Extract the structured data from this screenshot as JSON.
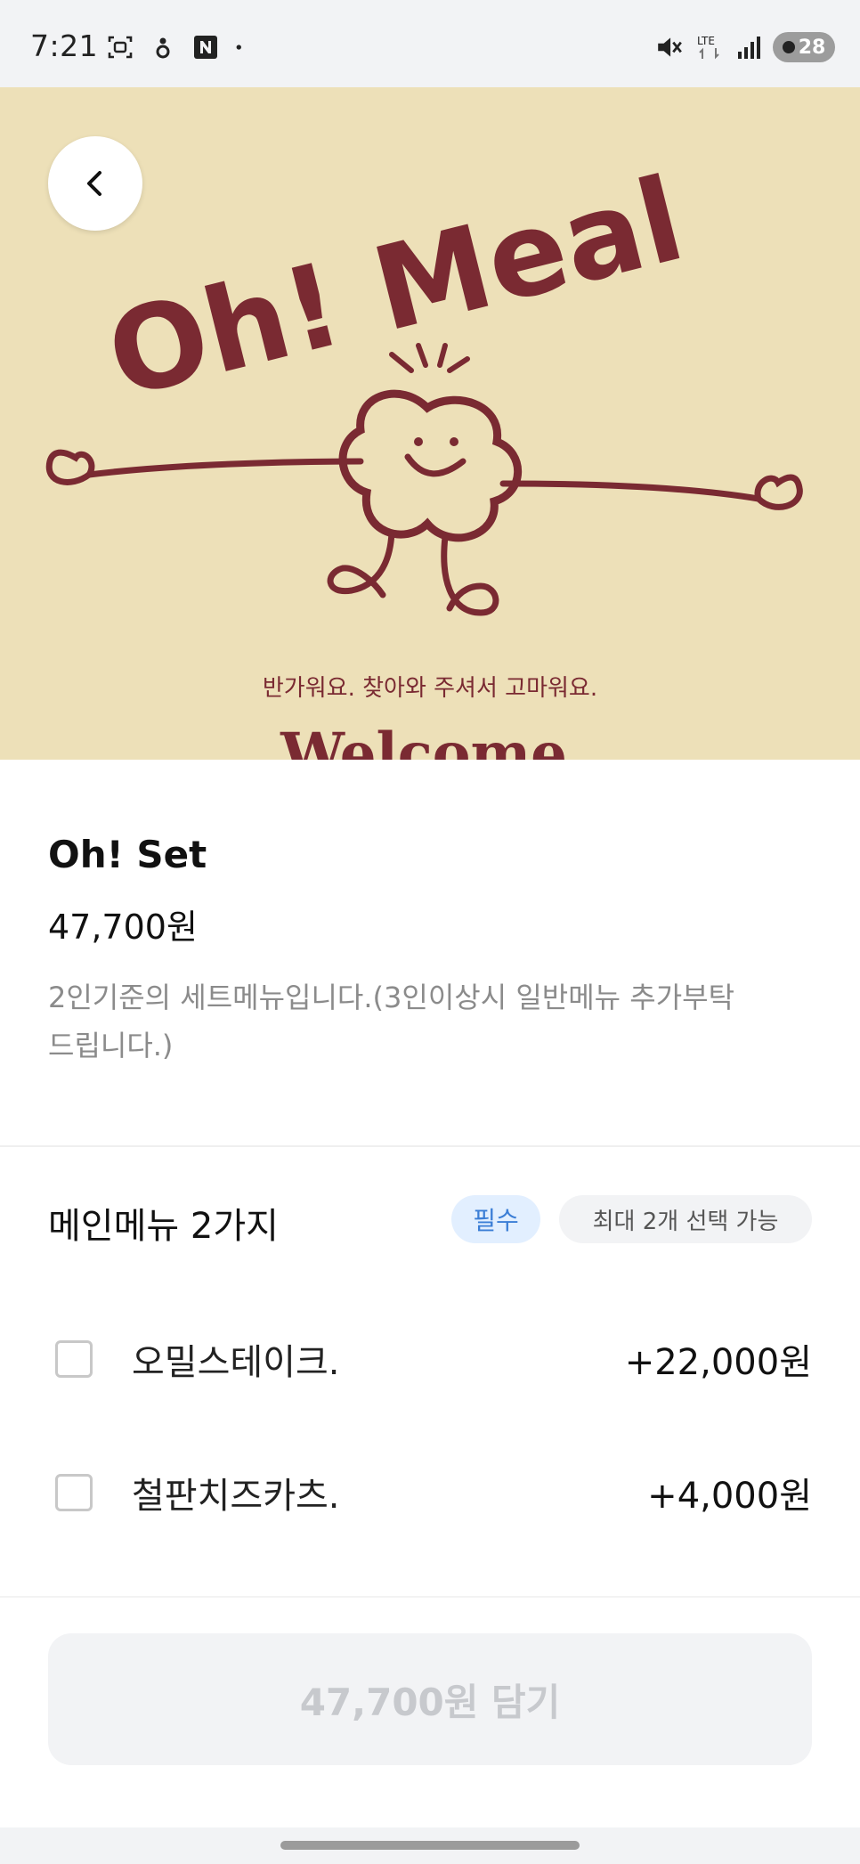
{
  "status_bar": {
    "time": "7:21",
    "network": "LTE",
    "battery": "28",
    "left_icons": [
      "screenshot-icon",
      "clover-icon",
      "naver-icon",
      "dot-icon"
    ],
    "right_icons": [
      "mute-icon",
      "lte-icon",
      "signal-icon",
      "battery-icon"
    ]
  },
  "hero": {
    "logo_text": "Oh! Meal",
    "greeting": "반가워요. 찾아와 주셔서 고마워요.",
    "welcome": "Welcome",
    "colors": {
      "background": "#ede0b8",
      "ink": "#7a2a32"
    }
  },
  "product": {
    "name": "Oh! Set",
    "price": "47,700원",
    "description": "2인기준의 세트메뉴입니다.(3인이상시 일반메뉴 추가부탁드립니다.)",
    "description_line1": "2인기준의 세트메뉴입니다.(3인이상시 일반메뉴 추가부탁",
    "description_line2": "드립니다.)"
  },
  "option_group": {
    "title": "메인메뉴 2가지",
    "required_badge": "필수",
    "max_badge": "최대 2개 선택 가능",
    "options": [
      {
        "label": "오밀스테이크.",
        "price": "+22,000원",
        "checked": false
      },
      {
        "label": "철판치즈카츠.",
        "price": "+4,000원",
        "checked": false
      }
    ]
  },
  "cta": {
    "label": "47,700원 담기",
    "enabled": false
  }
}
